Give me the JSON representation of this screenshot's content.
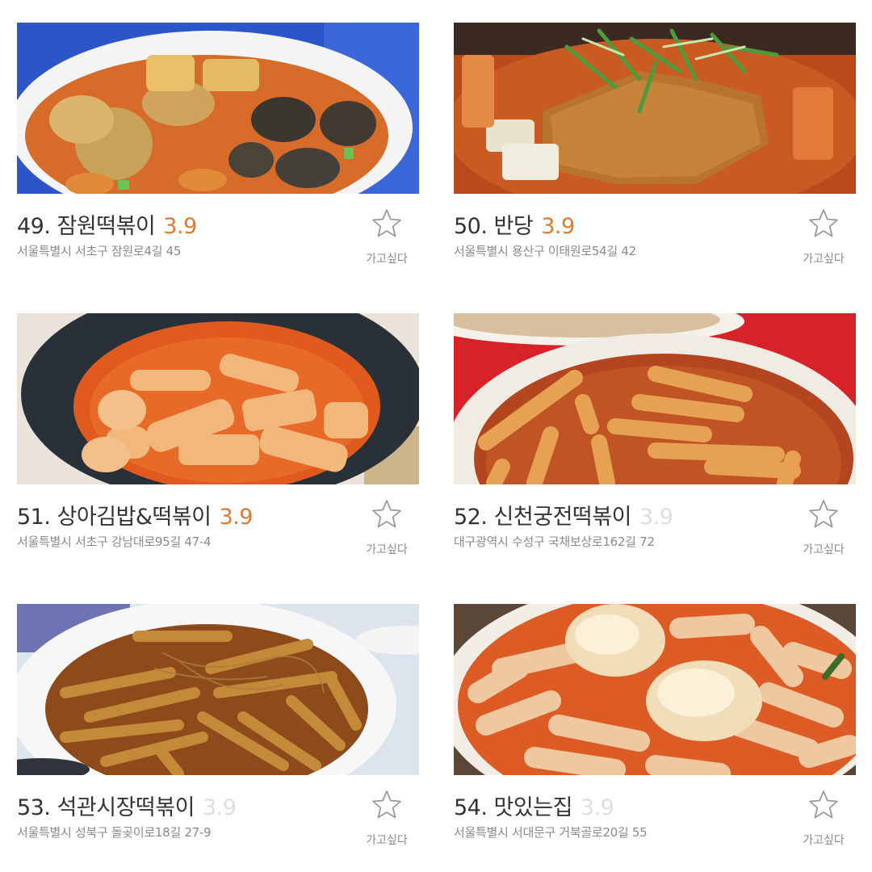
{
  "restaurants": [
    {
      "rank": "49.",
      "name": "잠원떡볶이",
      "rating": "3.9",
      "address": "서울특별시 서초구 잠원로4길 45",
      "wish_label": "가고싶다",
      "photo_alt": "tteokbokki with fried vegetables and seaweed rolls"
    },
    {
      "rank": "50.",
      "name": "반당",
      "rating": "3.9",
      "address": "서울특별시 용산구 이태원로54길 42",
      "wish_label": "가고싶다",
      "photo_alt": "tteokbokki with pork cutlet and green onions"
    },
    {
      "rank": "51.",
      "name": "상아김밥&떡볶이",
      "rating": "3.9",
      "address": "서울특별시 서초구 강남대로95길 47-4",
      "wish_label": "가고싶다",
      "photo_alt": "tteokbokki in dark bowl"
    },
    {
      "rank": "52.",
      "name": "신천궁전떡볶이",
      "rating": "3.9",
      "address": "대구광역시 수성구 국채보상로162길 72",
      "wish_label": "가고싶다",
      "photo_alt": "thin rice cakes in red sauce"
    },
    {
      "rank": "53.",
      "name": "석관시장떡볶이",
      "rating": "3.9",
      "address": "서울특별시 성북구 돌곶이로18길 27-9",
      "wish_label": "가고싶다",
      "photo_alt": "long rice cakes with glass noodles"
    },
    {
      "rank": "54.",
      "name": "맛있는집",
      "rating": "3.9",
      "address": "서울특별시 서대문구 거북골로20길 55",
      "wish_label": "가고싶다",
      "photo_alt": "tteokbokki with boiled eggs"
    }
  ],
  "colors": {
    "rating_highlight": "#e07a2d",
    "rating_muted": "#dedede",
    "title": "#333333",
    "address": "#8a8a8a"
  },
  "icons": {
    "wishlist": "star-outline-icon"
  }
}
